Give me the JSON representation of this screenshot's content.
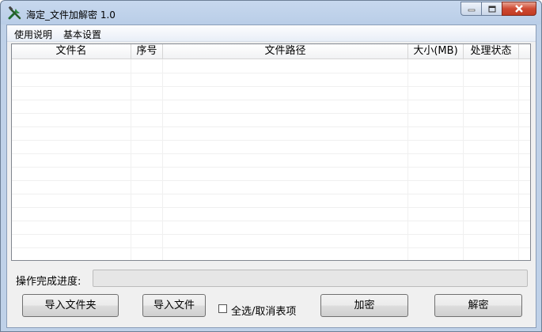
{
  "window": {
    "title": "海定_文件加解密 1.0",
    "icon": "tools-icon"
  },
  "menu": {
    "items": [
      "使用说明",
      "基本设置"
    ]
  },
  "table": {
    "columns": [
      "文件名",
      "序号",
      "文件路径",
      "大小(MB)",
      "处理状态"
    ],
    "rows": []
  },
  "progress": {
    "label": "操作完成进度:",
    "value": 0
  },
  "buttons": {
    "import_folder": "导入文件夹",
    "import_file": "导入文件",
    "encrypt": "加密",
    "decrypt": "解密"
  },
  "checkbox": {
    "label": "全选/取消表项",
    "checked": false
  },
  "colors": {
    "close_button": "#c13b22",
    "title_bar": "#b9cde7"
  }
}
